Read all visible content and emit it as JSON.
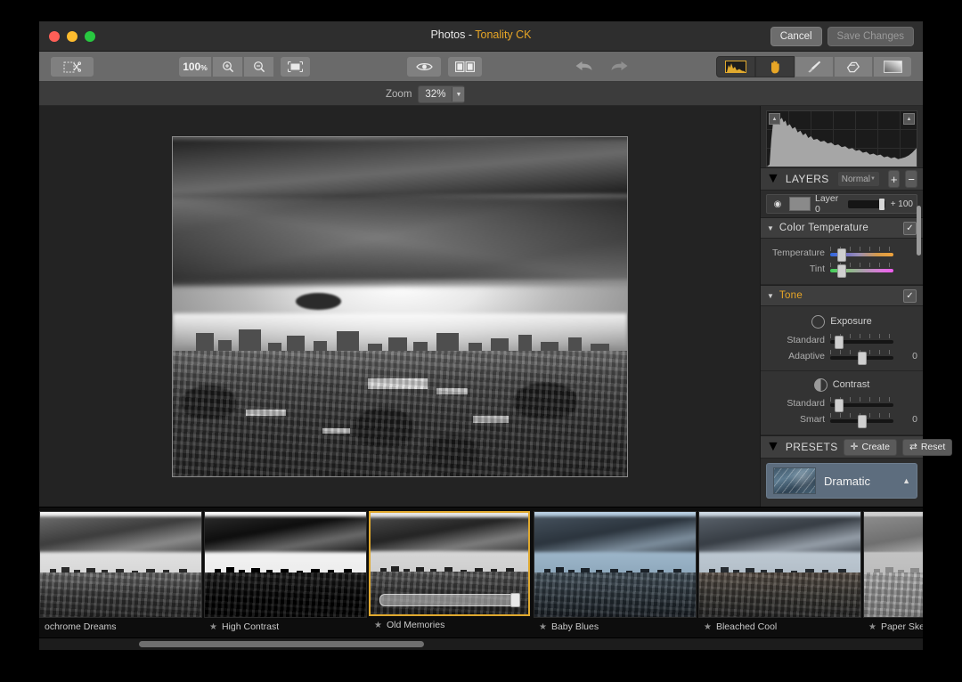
{
  "window": {
    "app_name": "Photos",
    "separator": " - ",
    "document_name": "Tonality CK",
    "cancel_label": "Cancel",
    "save_label": "Save Changes",
    "accent_color": "#e8a626"
  },
  "toolbar": {
    "crop_icon": "crop-scissors-icon",
    "zoom_100_label": "100",
    "zoom_100_suffix": "%",
    "zoom_in_icon": "zoom-in-icon",
    "zoom_out_icon": "zoom-out-icon",
    "fit_icon": "fit-to-screen-icon",
    "preview_icon": "eye-preview-icon",
    "compare_icon": "split-compare-icon",
    "undo_icon": "undo-arrow-icon",
    "redo_icon": "redo-arrow-icon",
    "histogram_icon": "histogram-icon",
    "hand_icon": "hand-tool-icon",
    "brush_icon": "brush-tool-icon",
    "eraser_icon": "eraser-tool-icon",
    "gradient_icon": "gradient-tool-icon"
  },
  "zoom_bar": {
    "label": "Zoom",
    "value": "32%",
    "dropdown_icon": "chevron-down-icon"
  },
  "panel": {
    "layers": {
      "title": "LAYERS",
      "collapse_icon": "triangle-down-icon",
      "blend_mode": "Normal",
      "blend_dropdown_icon": "chevron-down-icon",
      "add_label": "+",
      "remove_label": "−",
      "row": {
        "visibility_icon": "eye-icon",
        "name": "Layer 0",
        "opacity": "+ 100"
      }
    },
    "color_temperature": {
      "title": "Color Temperature",
      "enabled_icon": "checkmark-icon",
      "temperature_label": "Temperature",
      "tint_label": "Tint"
    },
    "tone": {
      "title": "Tone",
      "enabled_icon": "checkmark-icon",
      "exposure_title": "Exposure",
      "exposure_icon": "exposure-icon",
      "exposure_standard_label": "Standard",
      "exposure_adaptive_label": "Adaptive",
      "exposure_adaptive_value": "0",
      "contrast_title": "Contrast",
      "contrast_icon": "contrast-icon",
      "contrast_standard_label": "Standard",
      "contrast_smart_label": "Smart",
      "contrast_smart_value": "0"
    },
    "presets": {
      "title": "PRESETS",
      "collapse_icon": "triangle-down-icon",
      "create_label": "Create",
      "create_icon": "plus-icon",
      "reset_label": "Reset",
      "reset_icon": "refresh-icon",
      "selected_category": "Dramatic",
      "category_chevron_icon": "chevron-up-icon"
    }
  },
  "filmstrip": {
    "items": [
      {
        "name": "ochrome Dreams",
        "starred": false,
        "selected": false
      },
      {
        "name": "High Contrast",
        "starred": true,
        "selected": false
      },
      {
        "name": "Old Memories",
        "starred": true,
        "selected": true
      },
      {
        "name": "Baby Blues",
        "starred": true,
        "selected": false
      },
      {
        "name": "Bleached Cool",
        "starred": true,
        "selected": false
      },
      {
        "name": "Paper Sketch",
        "starred": true,
        "selected": false
      }
    ],
    "star_icon": "star-icon"
  }
}
